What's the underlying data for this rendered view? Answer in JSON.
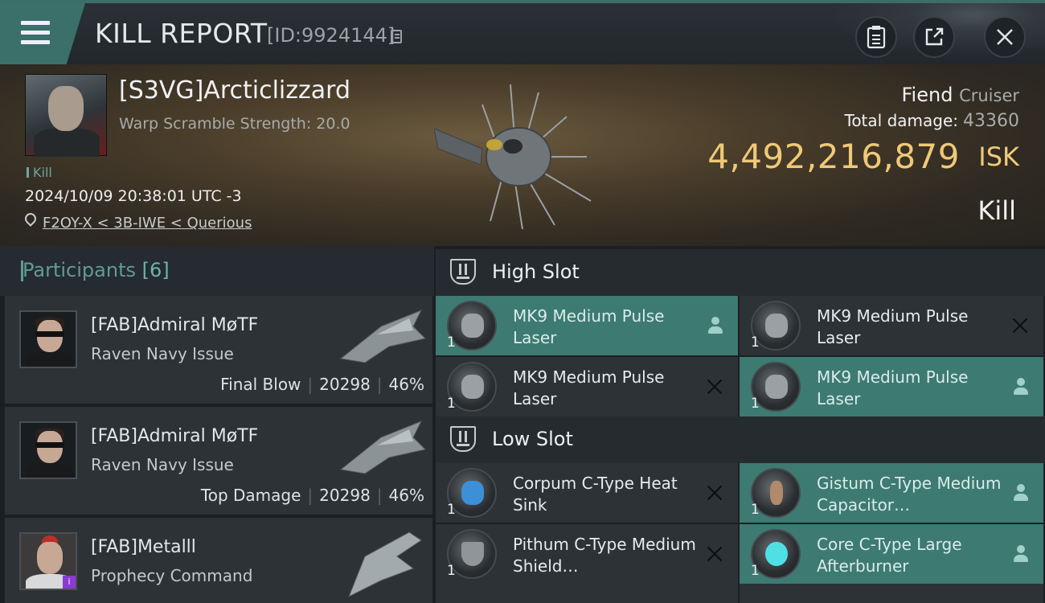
{
  "header": {
    "title": "KILL REPORT",
    "report_id": "[ID:9924144]",
    "buttons": [
      "clipboard-icon",
      "export-icon",
      "close-icon"
    ]
  },
  "victim": {
    "name": "[S3VG]Arcticlizzard",
    "warp_scramble": "Warp Scramble Strength: 20.0",
    "kill_tag": "Kill",
    "datetime": "2024/10/09 20:38:01 UTC -3",
    "location": "F2OY-X < 3B-IWE < Querious"
  },
  "ship": {
    "name": "Fiend",
    "class": "Cruiser",
    "total_damage_label": "Total damage:",
    "total_damage": "43360",
    "isk_value": "4,492,216,879",
    "isk_unit": "ISK",
    "result": "Kill"
  },
  "participants": {
    "title": "Participants",
    "count": "[6]",
    "rows": [
      {
        "name": "[FAB]Admiral MøTF",
        "ship": "Raven Navy Issue",
        "role": "Final Blow",
        "damage": "20298",
        "percent": "46%"
      },
      {
        "name": "[FAB]Admiral MøTF",
        "ship": "Raven Navy Issue",
        "role": "Top Damage",
        "damage": "20298",
        "percent": "46%"
      },
      {
        "name": "[FAB]Metalll",
        "ship": "Prophecy Command",
        "badge": "i"
      }
    ]
  },
  "fitting": {
    "high_slot": {
      "label": "High Slot",
      "modules": [
        {
          "qty": "1",
          "name": "MK9 Medium Pulse Laser",
          "status": "person",
          "active": true
        },
        {
          "qty": "1",
          "name": "MK9 Medium Pulse Laser",
          "status": "dropped",
          "active": false
        },
        {
          "qty": "1",
          "name": "MK9 Medium Pulse Laser",
          "status": "dropped",
          "active": false
        },
        {
          "qty": "1",
          "name": "MK9 Medium Pulse Laser",
          "status": "person",
          "active": true
        }
      ]
    },
    "low_slot": {
      "label": "Low Slot",
      "modules": [
        {
          "qty": "1",
          "name": "Corpum C-Type Heat Sink",
          "status": "dropped",
          "active": false
        },
        {
          "qty": "1",
          "name": "Gistum C-Type Medium Capacitor…",
          "status": "person",
          "active": true
        },
        {
          "qty": "1",
          "name": "Pithum C-Type Medium Shield…",
          "status": "dropped",
          "active": false
        },
        {
          "qty": "1",
          "name": "Core C-Type Large Afterburner",
          "status": "person",
          "active": true
        }
      ]
    }
  }
}
